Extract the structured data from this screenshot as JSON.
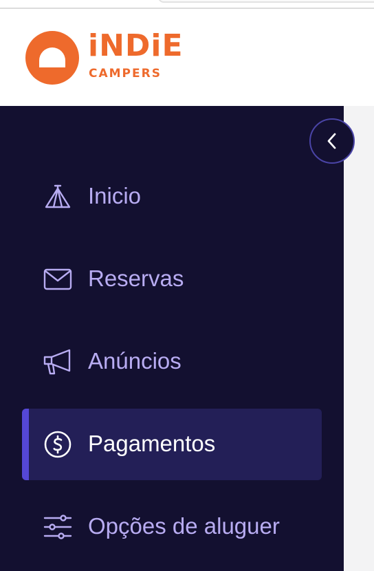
{
  "brand": {
    "name_top": "iNDiE",
    "name_bottom": "CAMPERS",
    "color": "#ee6a2c"
  },
  "sidebar": {
    "background": "#131030",
    "active_background": "#231f57",
    "accent": "#5547d6",
    "label_color": "#b8acf2",
    "collapse_icon": "chevron-left-icon",
    "items": [
      {
        "label": "Inicio",
        "icon": "tent-icon",
        "active": false
      },
      {
        "label": "Reservas",
        "icon": "envelope-icon",
        "active": false
      },
      {
        "label": "Anúncios",
        "icon": "megaphone-icon",
        "active": false
      },
      {
        "label": "Pagamentos",
        "icon": "dollar-circle-icon",
        "active": true
      },
      {
        "label": "Opções de aluguer",
        "icon": "sliders-icon",
        "active": false
      }
    ]
  }
}
